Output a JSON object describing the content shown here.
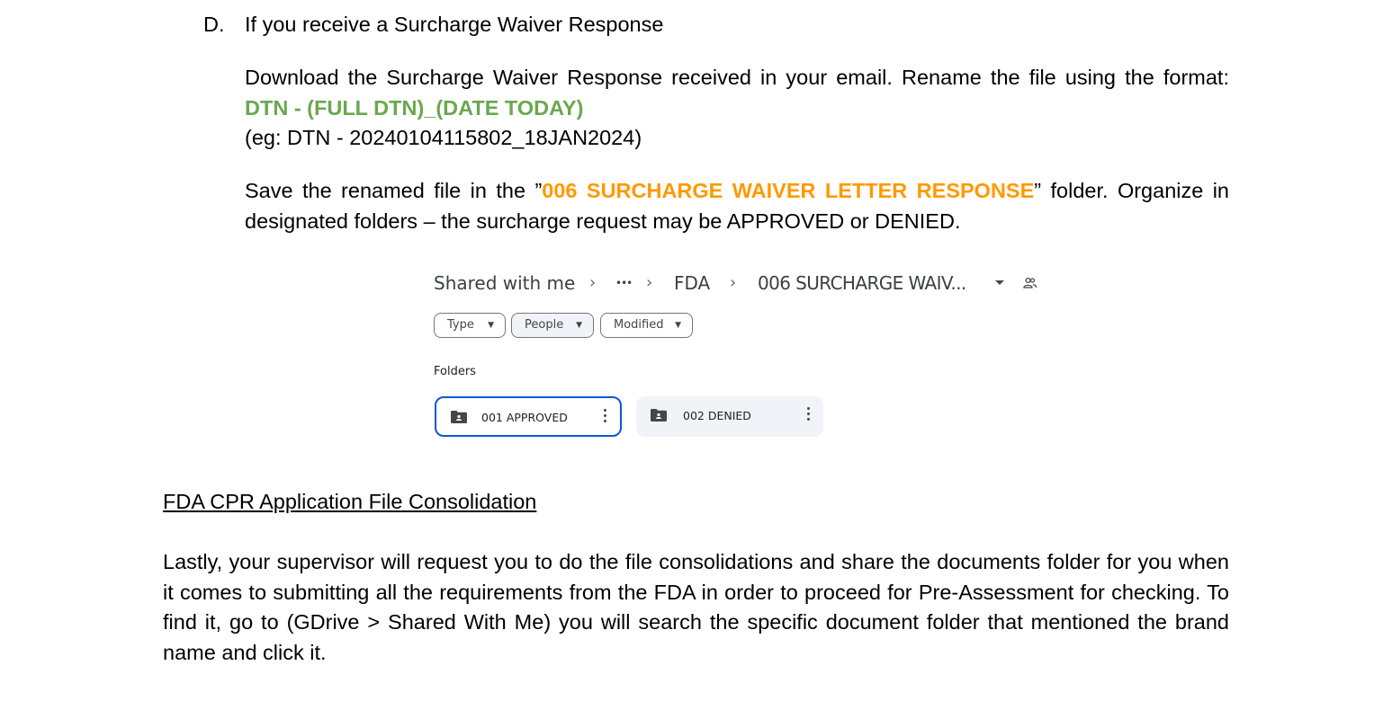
{
  "section_d": {
    "marker": "D.",
    "heading": "If you receive a Surcharge Waiver Response",
    "para1_prefix": "Download the Surcharge Waiver Response received in your email. Rename the file using the format: ",
    "para1_format": "DTN -  (FULL DTN)_(DATE TODAY)",
    "para1_example": "(eg: DTN - 20240104115802_18JAN2024)",
    "para2_prefix": "Save the renamed file in the ”",
    "para2_folder": "006 SURCHARGE WAIVER LETTER RESPONSE",
    "para2_suffix": "” folder. Organize in designated folders – the surcharge request may be APPROVED or DENIED."
  },
  "drive": {
    "breadcrumb": [
      "Shared with me",
      "•••",
      "FDA",
      "006 SURCHARGE WAIV..."
    ],
    "separator": "›",
    "dropdown_icon": "caret-down-icon",
    "shared_icon": "people-icon",
    "filters": [
      "Type",
      "People",
      "Modified"
    ],
    "folders_label": "Folders",
    "folders": [
      {
        "name": "001 APPROVED",
        "selected": true
      },
      {
        "name": "002 DENIED",
        "selected": false
      }
    ],
    "colors": {
      "selected_border": "#0b57d0",
      "card_bg": "#f0f4f9"
    }
  },
  "consolidation": {
    "heading": "FDA CPR Application File Consolidation",
    "body": "Lastly, your supervisor will request you to do the file consolidations and share the documents folder for you when it comes to submitting all the requirements from the FDA in order to proceed for Pre-Assessment for checking. To find it, go to (GDrive > Shared With Me) you will search the specific document folder that mentioned the brand name and click it."
  },
  "colors": {
    "green": "#6aa84f",
    "orange": "#ff9900"
  }
}
